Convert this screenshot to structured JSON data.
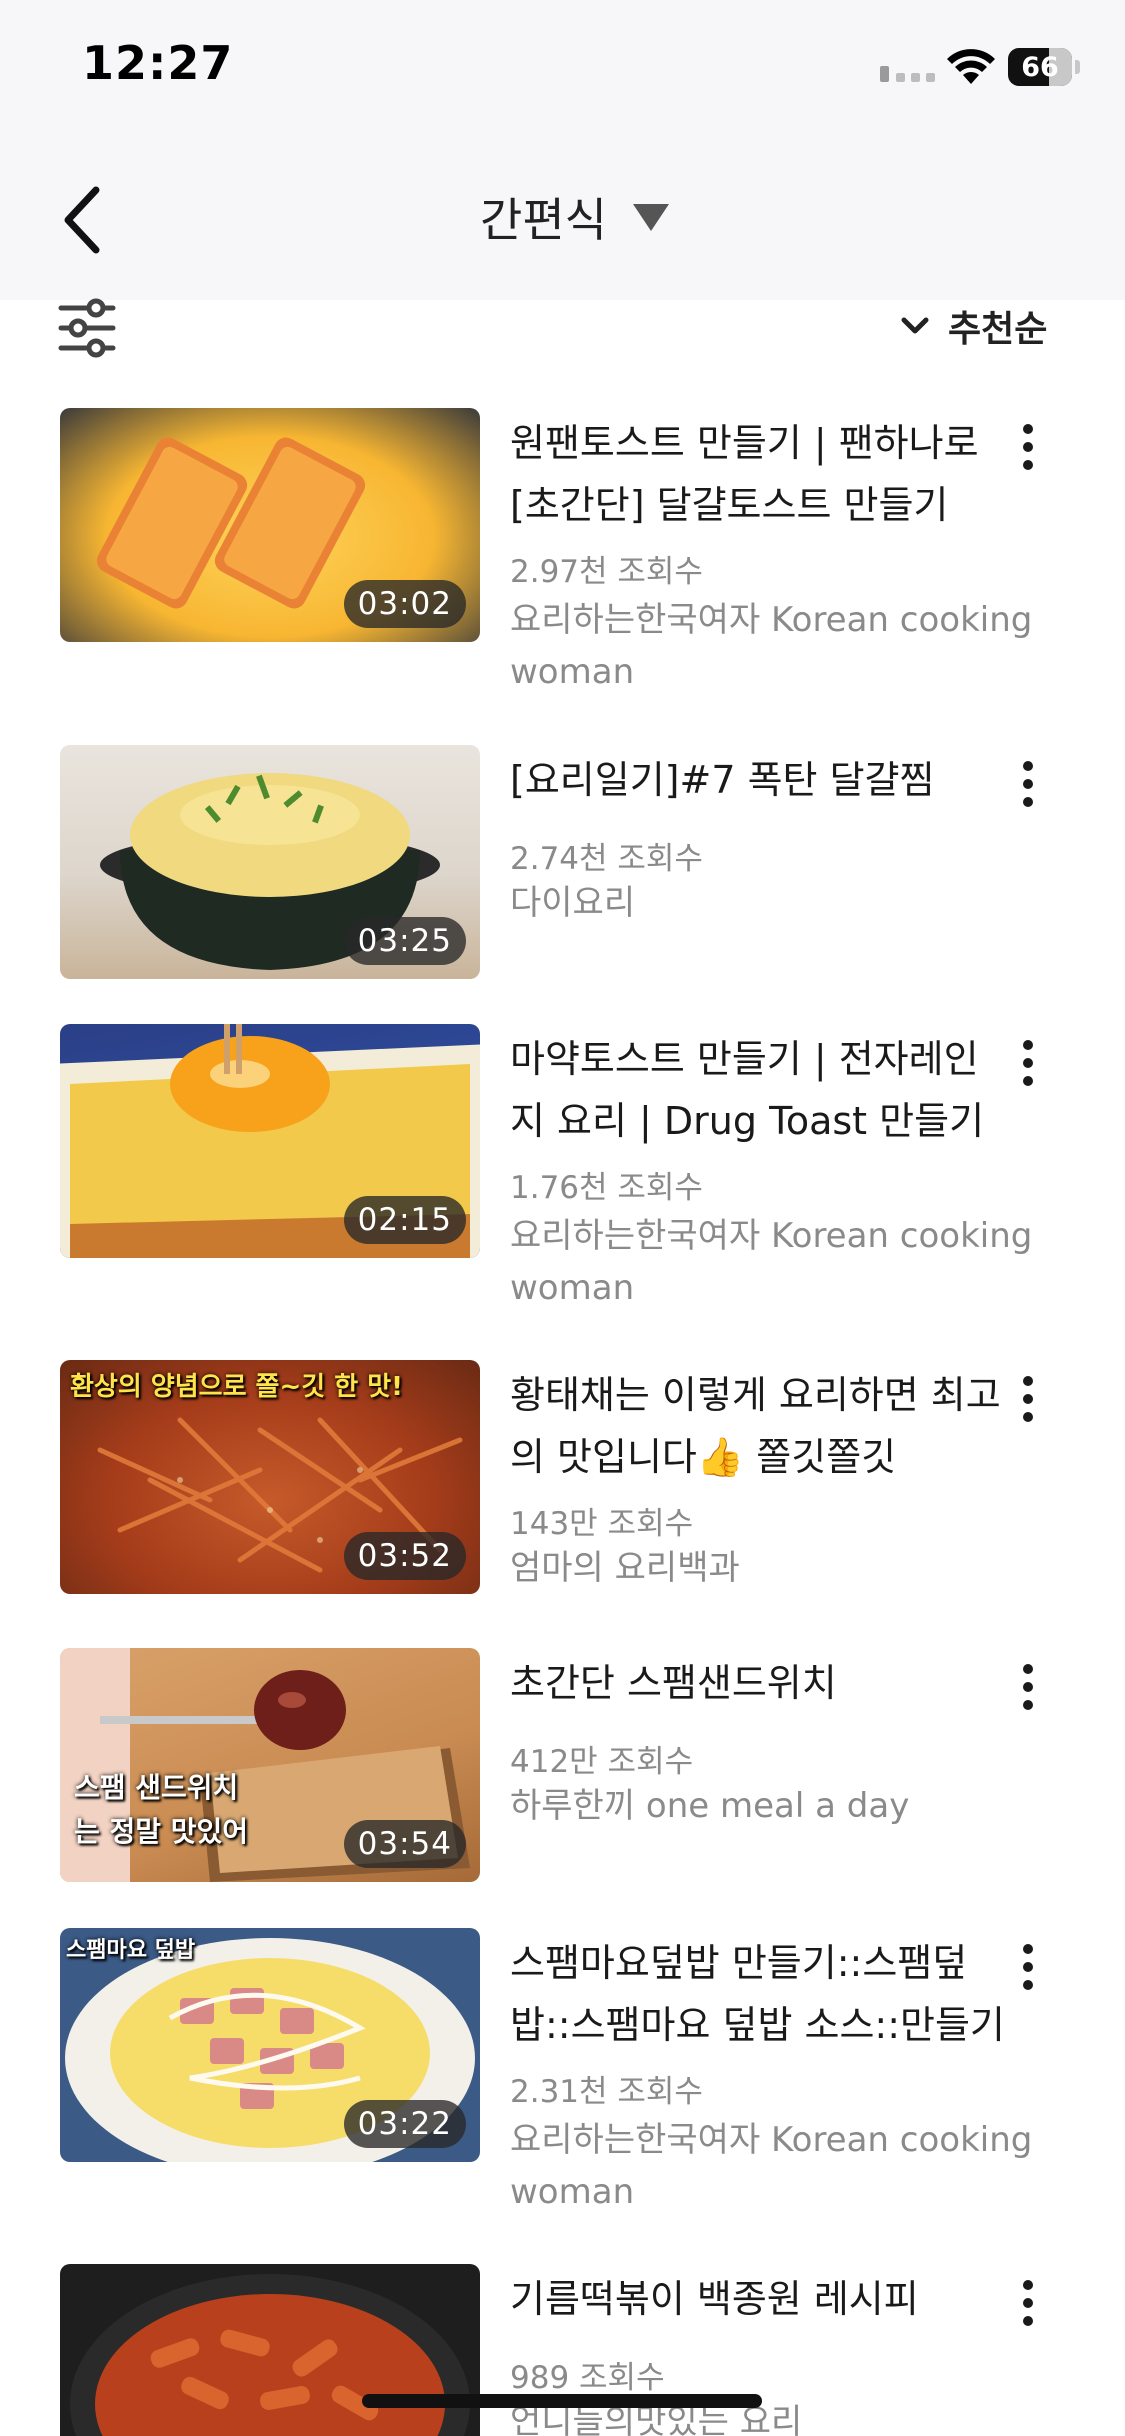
{
  "status_bar": {
    "time": "12:27",
    "battery": "66"
  },
  "nav": {
    "title": "간편식",
    "sort_label": "추천순"
  },
  "videos": [
    {
      "title": "원팬토스트 만들기 | 팬하나로 [초간단] 달걀토스트 만들기",
      "views": "2.97천 조회수",
      "channel": "요리하는한국여자 Korean cooking woman",
      "duration": "03:02"
    },
    {
      "title": "[요리일기]#7 폭탄 달걀찜",
      "views": "2.74천 조회수",
      "channel": "다이요리",
      "duration": "03:25"
    },
    {
      "title": "마약토스트 만들기 | 전자레인지 요리 | Drug Toast 만들기",
      "views": "1.76천 조회수",
      "channel": "요리하는한국여자 Korean cooking woman",
      "duration": "02:15"
    },
    {
      "title": "황태채는 이렇게 요리하면 최고의 맛입니다👍 쫄깃쫄깃",
      "views": "143만 조회수",
      "channel": "엄마의 요리백과",
      "duration": "03:52",
      "overlay": "환상의 양념으로 쫄~깃 한 맛!"
    },
    {
      "title": "초간단 스팸샌드위치",
      "views": "412만 조회수",
      "channel": "하루한끼 one meal a day",
      "duration": "03:54",
      "overlay": "스팸 샌드위치는 정말 맛있어"
    },
    {
      "title": "스팸마요덮밥 만들기::스팸덮밥::스팸마요 덮밥 소스::만들기",
      "views": "2.31천 조회수",
      "channel": "요리하는한국여자 Korean cooking woman",
      "duration": "03:22",
      "overlay": "스팸마요 덮밥"
    },
    {
      "title": "기름떡볶이 백종원 레시피",
      "views": "989 조회수",
      "channel": "언니들의맛있는 요리"
    }
  ]
}
